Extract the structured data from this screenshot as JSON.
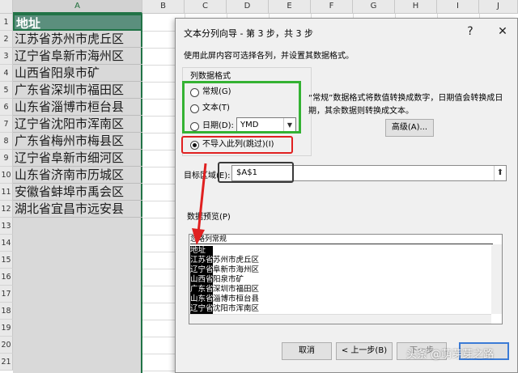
{
  "sheet": {
    "columns": [
      "A",
      "B",
      "C",
      "D",
      "E",
      "F",
      "G",
      "H",
      "I",
      "J"
    ],
    "rows": [
      "1",
      "2",
      "3",
      "4",
      "5",
      "6",
      "7",
      "8",
      "9",
      "10",
      "11",
      "12",
      "13",
      "14",
      "15",
      "16",
      "17",
      "18",
      "19",
      "20",
      "21"
    ],
    "cells_a": [
      "地址",
      "江苏省苏州市虎丘区",
      "辽宁省阜新市海州区",
      "山西省阳泉市矿",
      "广东省深圳市福田区",
      "山东省淄博市桓台县",
      "辽宁省沈阳市浑南区",
      "广东省梅州市梅县区",
      "辽宁省阜新市细河区",
      "山东省济南市历城区",
      "安徽省蚌埠市禹会区",
      "湖北省宜昌市远安县"
    ],
    "selected_column": "A"
  },
  "dialog": {
    "title": "文本分列向导 - 第 3 步，共 3 步",
    "help_button": "?",
    "close_button": "✕",
    "description": "使用此屏内容可选择各列，并设置其数据格式。",
    "format_group_label": "列数据格式",
    "options": [
      {
        "label": "常规(G)",
        "selected": false
      },
      {
        "label": "文本(T)",
        "selected": false
      },
      {
        "label": "日期(D):",
        "selected": false
      },
      {
        "label": "不导入此列(跳过)(I)",
        "selected": true
      }
    ],
    "date_format": "YMD",
    "note": "“常规”数据格式将数值转换成数字，日期值会转换成日期，其余数据则转换成文本。",
    "advanced_button": "高级(A)...",
    "destination_label": "目标区域(E):",
    "destination_value": "$A$1",
    "preview_label": "数据预览(P)",
    "preview_header": [
      "忽略列",
      "常规"
    ],
    "preview_col1": [
      "地址",
      "江苏省",
      "辽宁省",
      "山西省",
      "广东省",
      "山东省",
      "辽宁省"
    ],
    "preview_col2": [
      "",
      "苏州市虎丘区",
      "阜新市海州区",
      "阳泉市矿",
      "深圳市福田区",
      "淄博市桓台县",
      "沈阳市浑南区"
    ],
    "buttons": {
      "cancel": "取消",
      "back": "< 上一步(B)",
      "next": "下一步"
    },
    "watermark": "头条 @萌芽芽之路"
  },
  "colors": {
    "accent_green": "#217346",
    "highlight_green": "#34b233",
    "highlight_red": "#e02020"
  }
}
